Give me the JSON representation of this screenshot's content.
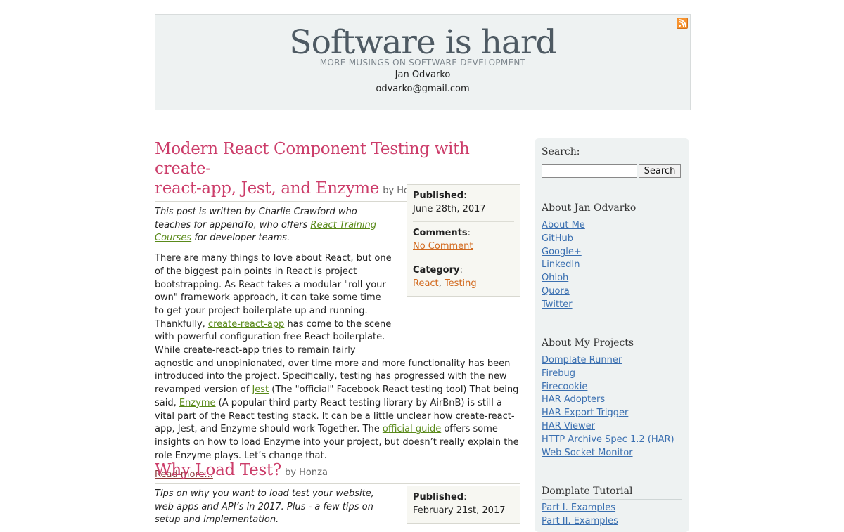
{
  "header": {
    "title": "Software is hard",
    "tagline": "MORE MUSINGS ON SOFTWARE DEVELOPMENT",
    "author": "Jan Odvarko",
    "email": "odvarko@gmail.com",
    "rss_icon": "rss-feed-icon"
  },
  "posts": [
    {
      "title_line1": "Modern React Component Testing with create-",
      "title_line2": "react-app, Jest, and Enzyme",
      "by": "by",
      "author": "Honza",
      "meta": {
        "published_label": "Published",
        "published_value": "June 28th, 2017",
        "comments_label": "Comments",
        "comments_value": "No Comment",
        "category_label": "Category",
        "categories": [
          "React",
          "Testing"
        ]
      },
      "intro": {
        "before": "This post is written by Charlie Crawford who teaches for appendTo, who offers ",
        "link": "React Training Courses",
        "after": " for developer teams."
      },
      "body": {
        "p1": "There are many things to love about React, but one of the biggest pain points in React is project bootstrapping. As React takes a modular \"roll your own\" framework approach, it can take some time to get your project boilerplate up and running. Thankfully, ",
        "link1": "create-react-app",
        "p2": " has come to the scene with powerful configuration free React boilerplate. While create-react-app tries to remain fairly agnostic and unopinionated, over time more and more functionality has been introduced into the project. Specifically, testing has progressed with the new revamped version of ",
        "link2": "Jest",
        "p3": " (The \"official\" Facebook React testing tool) That being said, ",
        "link3": "Enzyme",
        "p4": " (A popular third party React testing library by AirBnB) is still a vital part of the React testing stack. It can be a little unclear how create-react-app, Jest, and Enzyme should work Together. The ",
        "link4": "official guide",
        "p5": " offers some insights on how to load Enzyme into your project, but doesn’t really explain the role Enzyme plays. Let’s change that."
      },
      "read_more": "Read more..."
    },
    {
      "title_line1": "Why Load Test?",
      "by": "by",
      "author": "Honza",
      "meta": {
        "published_label": "Published",
        "published_value": "February 21st, 2017"
      },
      "intro": "Tips on why you want to load test your website, web apps and API’s in 2017. Plus - a few tips on setup and implementation."
    }
  ],
  "sidebar": {
    "search": {
      "label": "Search:",
      "button": "Search",
      "value": ""
    },
    "about": {
      "heading": "About Jan Odvarko",
      "links": [
        "About Me",
        "GitHub",
        "Google+",
        "LinkedIn",
        "Ohloh",
        "Quora",
        "Twitter"
      ]
    },
    "projects": {
      "heading": "About My Projects",
      "links": [
        "Domplate Runner",
        "Firebug",
        "Firecookie",
        "HAR Adopters",
        "HAR Export Trigger",
        "HAR Viewer",
        "HTTP Archive Spec 1.2 (HAR)",
        "Web Socket Monitor"
      ]
    },
    "tutorial": {
      "heading": "Domplate Tutorial",
      "links": [
        "Part I. Examples",
        "Part II. Examples"
      ]
    }
  }
}
